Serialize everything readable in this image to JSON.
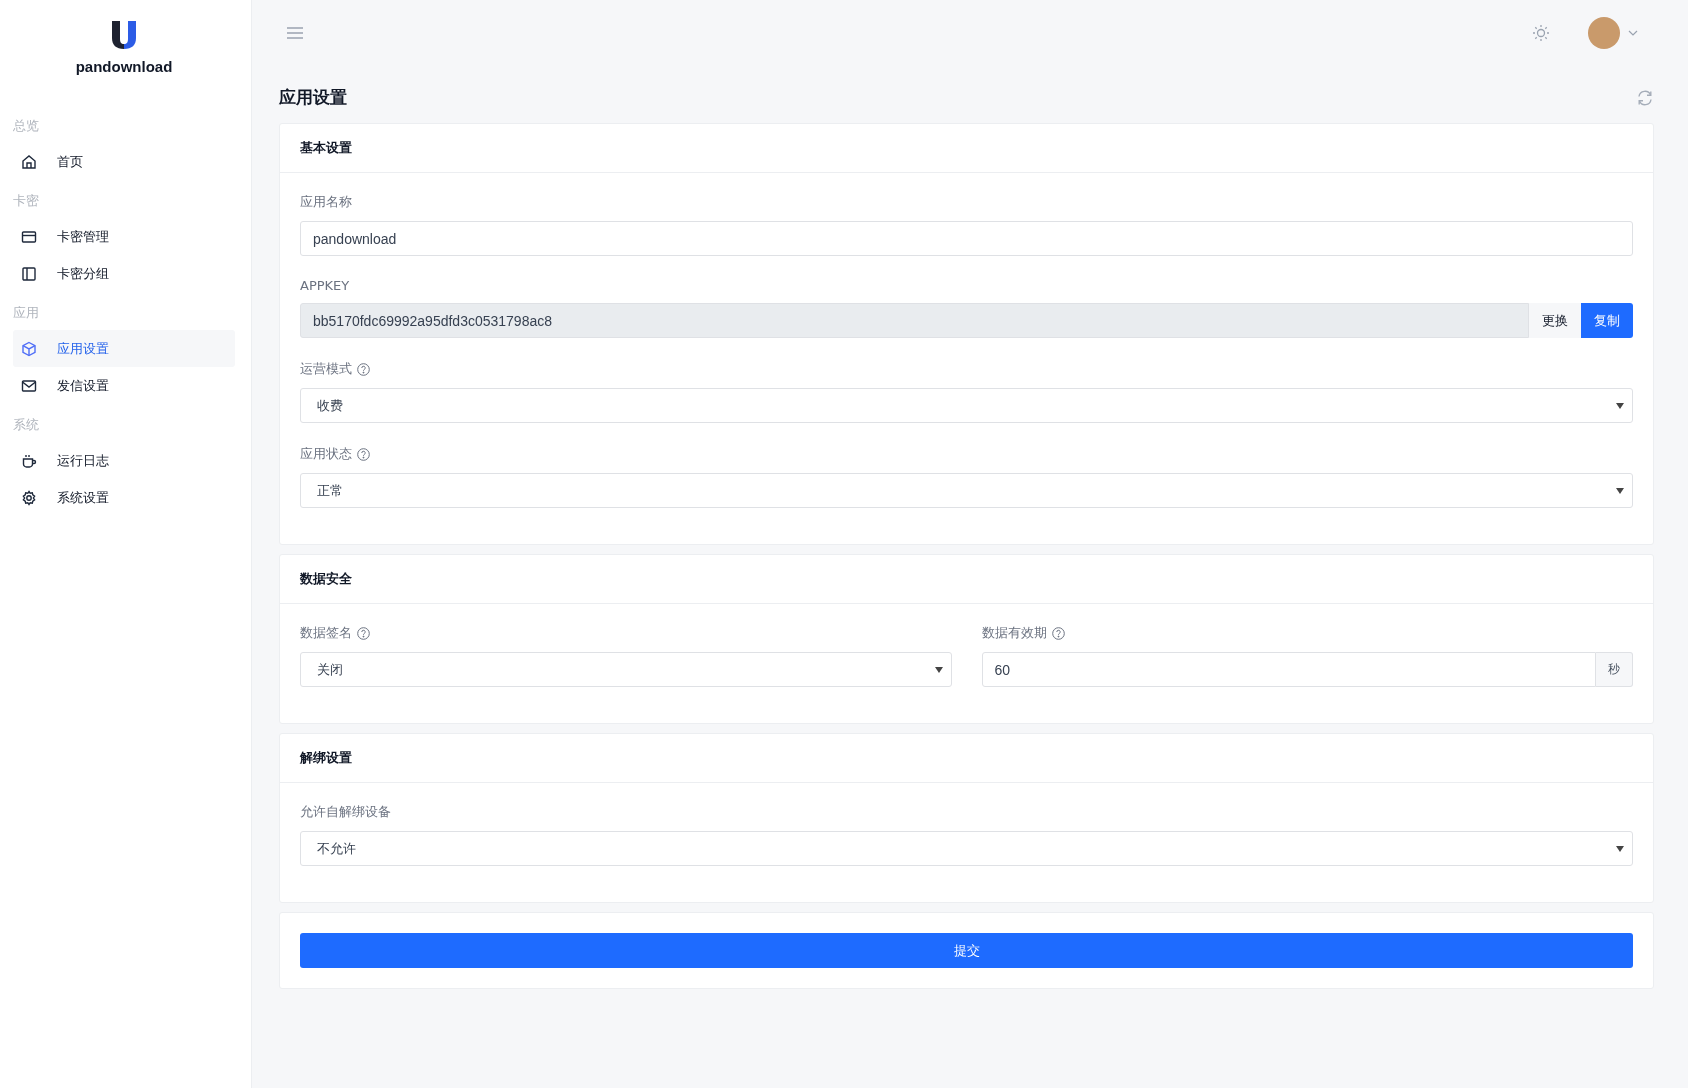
{
  "sidebar": {
    "brand": "pandownload",
    "groups": [
      {
        "title": "总览",
        "items": [
          {
            "label": "首页",
            "selected": false
          }
        ]
      },
      {
        "title": "卡密",
        "items": [
          {
            "label": "卡密管理",
            "selected": false
          },
          {
            "label": "卡密分组",
            "selected": false
          }
        ]
      },
      {
        "title": "应用",
        "items": [
          {
            "label": "应用设置",
            "selected": true
          },
          {
            "label": "发信设置",
            "selected": false
          }
        ]
      },
      {
        "title": "系统",
        "items": [
          {
            "label": "运行日志",
            "selected": false
          },
          {
            "label": "系统设置",
            "selected": false
          }
        ]
      }
    ]
  },
  "page_title": "应用设置",
  "sections": [
    {
      "title": "基本设置",
      "fields": [
        {
          "kind": "text",
          "label": "应用名称",
          "help": false,
          "value": "pandownload"
        },
        {
          "kind": "readonly",
          "label": "APPKEY",
          "help": false,
          "value": "bb5170fdc69992a95dfd3c0531798ac8",
          "buttons": [
            {
              "label": "更换",
              "kind": "plain"
            },
            {
              "label": "复制",
              "kind": "primary"
            }
          ]
        },
        {
          "kind": "select",
          "label": "运营模式",
          "help": true,
          "value": "收费"
        },
        {
          "kind": "select",
          "label": "应用状态",
          "help": true,
          "value": "正常"
        }
      ]
    },
    {
      "title": "数据安全",
      "columns": [
        {
          "kind": "select",
          "label": "数据签名",
          "help": true,
          "value": "关闭"
        },
        {
          "kind": "suffix",
          "label": "数据有效期",
          "help": true,
          "value": "60",
          "suffix": "秒"
        }
      ]
    },
    {
      "title": "解绑设置",
      "fields": [
        {
          "kind": "select",
          "label": "允许自解绑设备",
          "help": false,
          "value": "不允许"
        }
      ]
    }
  ],
  "submit": "提交"
}
